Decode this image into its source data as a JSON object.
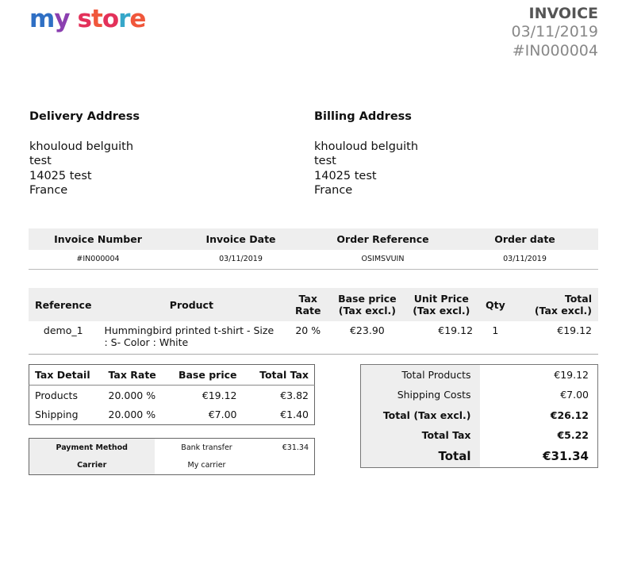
{
  "logo": {
    "word1": "my",
    "word2": "store"
  },
  "invoice": {
    "title": "INVOICE",
    "date": "03/11/2019",
    "number": "#IN000004"
  },
  "delivery": {
    "title": "Delivery Address",
    "lines": [
      "khouloud belguith",
      "test",
      "14025 test",
      "France"
    ]
  },
  "billing": {
    "title": "Billing Address",
    "lines": [
      "khouloud belguith",
      "test",
      "14025 test",
      "France"
    ]
  },
  "info_table": {
    "headers": [
      "Invoice Number",
      "Invoice Date",
      "Order Reference",
      "Order date"
    ],
    "values": [
      "#IN000004",
      "03/11/2019",
      "OSIMSVUIN",
      "03/11/2019"
    ]
  },
  "product_table": {
    "headers": {
      "reference": "Reference",
      "product": "Product",
      "tax_rate_1": "Tax",
      "tax_rate_2": "Rate",
      "base_1": "Base price",
      "base_2": "(Tax excl.)",
      "unit_1": "Unit Price",
      "unit_2": "(Tax excl.)",
      "qty": "Qty",
      "total_1": "Total",
      "total_2": "(Tax excl.)"
    },
    "rows": [
      {
        "reference": "demo_1",
        "product": "Hummingbird printed t-shirt - Size : S- Color : White",
        "tax_rate": "20 %",
        "base_price": "€23.90",
        "unit_price": "€19.12",
        "qty": "1",
        "total": "€19.12"
      }
    ]
  },
  "tax_detail": {
    "headers": [
      "Tax Detail",
      "Tax Rate",
      "Base price",
      "Total Tax"
    ],
    "rows": [
      [
        "Products",
        "20.000 %",
        "€19.12",
        "€3.82"
      ],
      [
        "Shipping",
        "20.000 %",
        "€7.00",
        "€1.40"
      ]
    ]
  },
  "payment": {
    "method_label": "Payment Method",
    "method_value": "Bank transfer",
    "method_amount": "€31.34",
    "carrier_label": "Carrier",
    "carrier_value": "My carrier"
  },
  "totals": {
    "rows": [
      {
        "label": "Total Products",
        "value": "€19.12"
      },
      {
        "label": "Shipping Costs",
        "value": "€7.00"
      },
      {
        "label": "Total (Tax excl.)",
        "value": "€26.12"
      },
      {
        "label": "Total Tax",
        "value": "€5.22"
      },
      {
        "label": "Total",
        "value": "€31.34"
      }
    ]
  }
}
